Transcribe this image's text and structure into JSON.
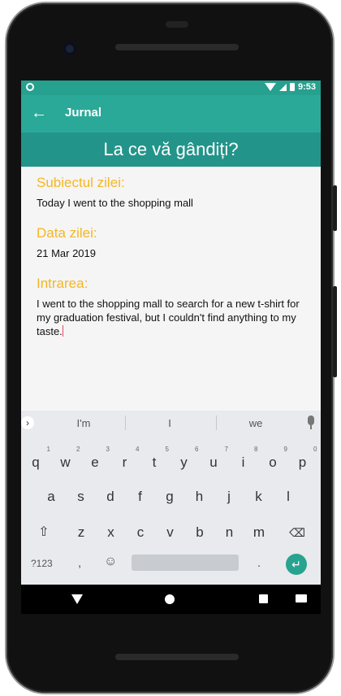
{
  "status": {
    "time": "9:53"
  },
  "appbar": {
    "title": "Jurnal"
  },
  "banner": {
    "text": "La ce vă gândiți?"
  },
  "fields": {
    "subject_label": "Subiectul zilei:",
    "subject_value": "Today I went to the shopping mall",
    "date_label": "Data zilei:",
    "date_value": "21 Mar 2019",
    "entry_label": "Intrarea:",
    "entry_value": "I went to the shopping mall to search for a new t-shirt for my graduation festival, but I couldn't find anything to my taste."
  },
  "keyboard": {
    "suggestions": [
      "I'm",
      "I",
      "we"
    ],
    "row1": [
      "q",
      "w",
      "e",
      "r",
      "t",
      "y",
      "u",
      "i",
      "o",
      "p"
    ],
    "row1_hints": [
      "1",
      "2",
      "3",
      "4",
      "5",
      "6",
      "7",
      "8",
      "9",
      "0"
    ],
    "row2": [
      "a",
      "s",
      "d",
      "f",
      "g",
      "h",
      "j",
      "k",
      "l"
    ],
    "row3": [
      "z",
      "x",
      "c",
      "v",
      "b",
      "n",
      "m"
    ],
    "symbols_label": "?123",
    "comma": ",",
    "period": "."
  },
  "colors": {
    "statusbar": "#26a08f",
    "appbar": "#2aa999",
    "banner": "#23948a",
    "label": "#f5b623",
    "enter": "#27a38f"
  },
  "icons": [
    "back-arrow-icon",
    "wifi-icon",
    "signal-icon",
    "battery-icon",
    "shift-icon",
    "backspace-icon",
    "emoji-icon",
    "enter-icon",
    "mic-icon"
  ]
}
